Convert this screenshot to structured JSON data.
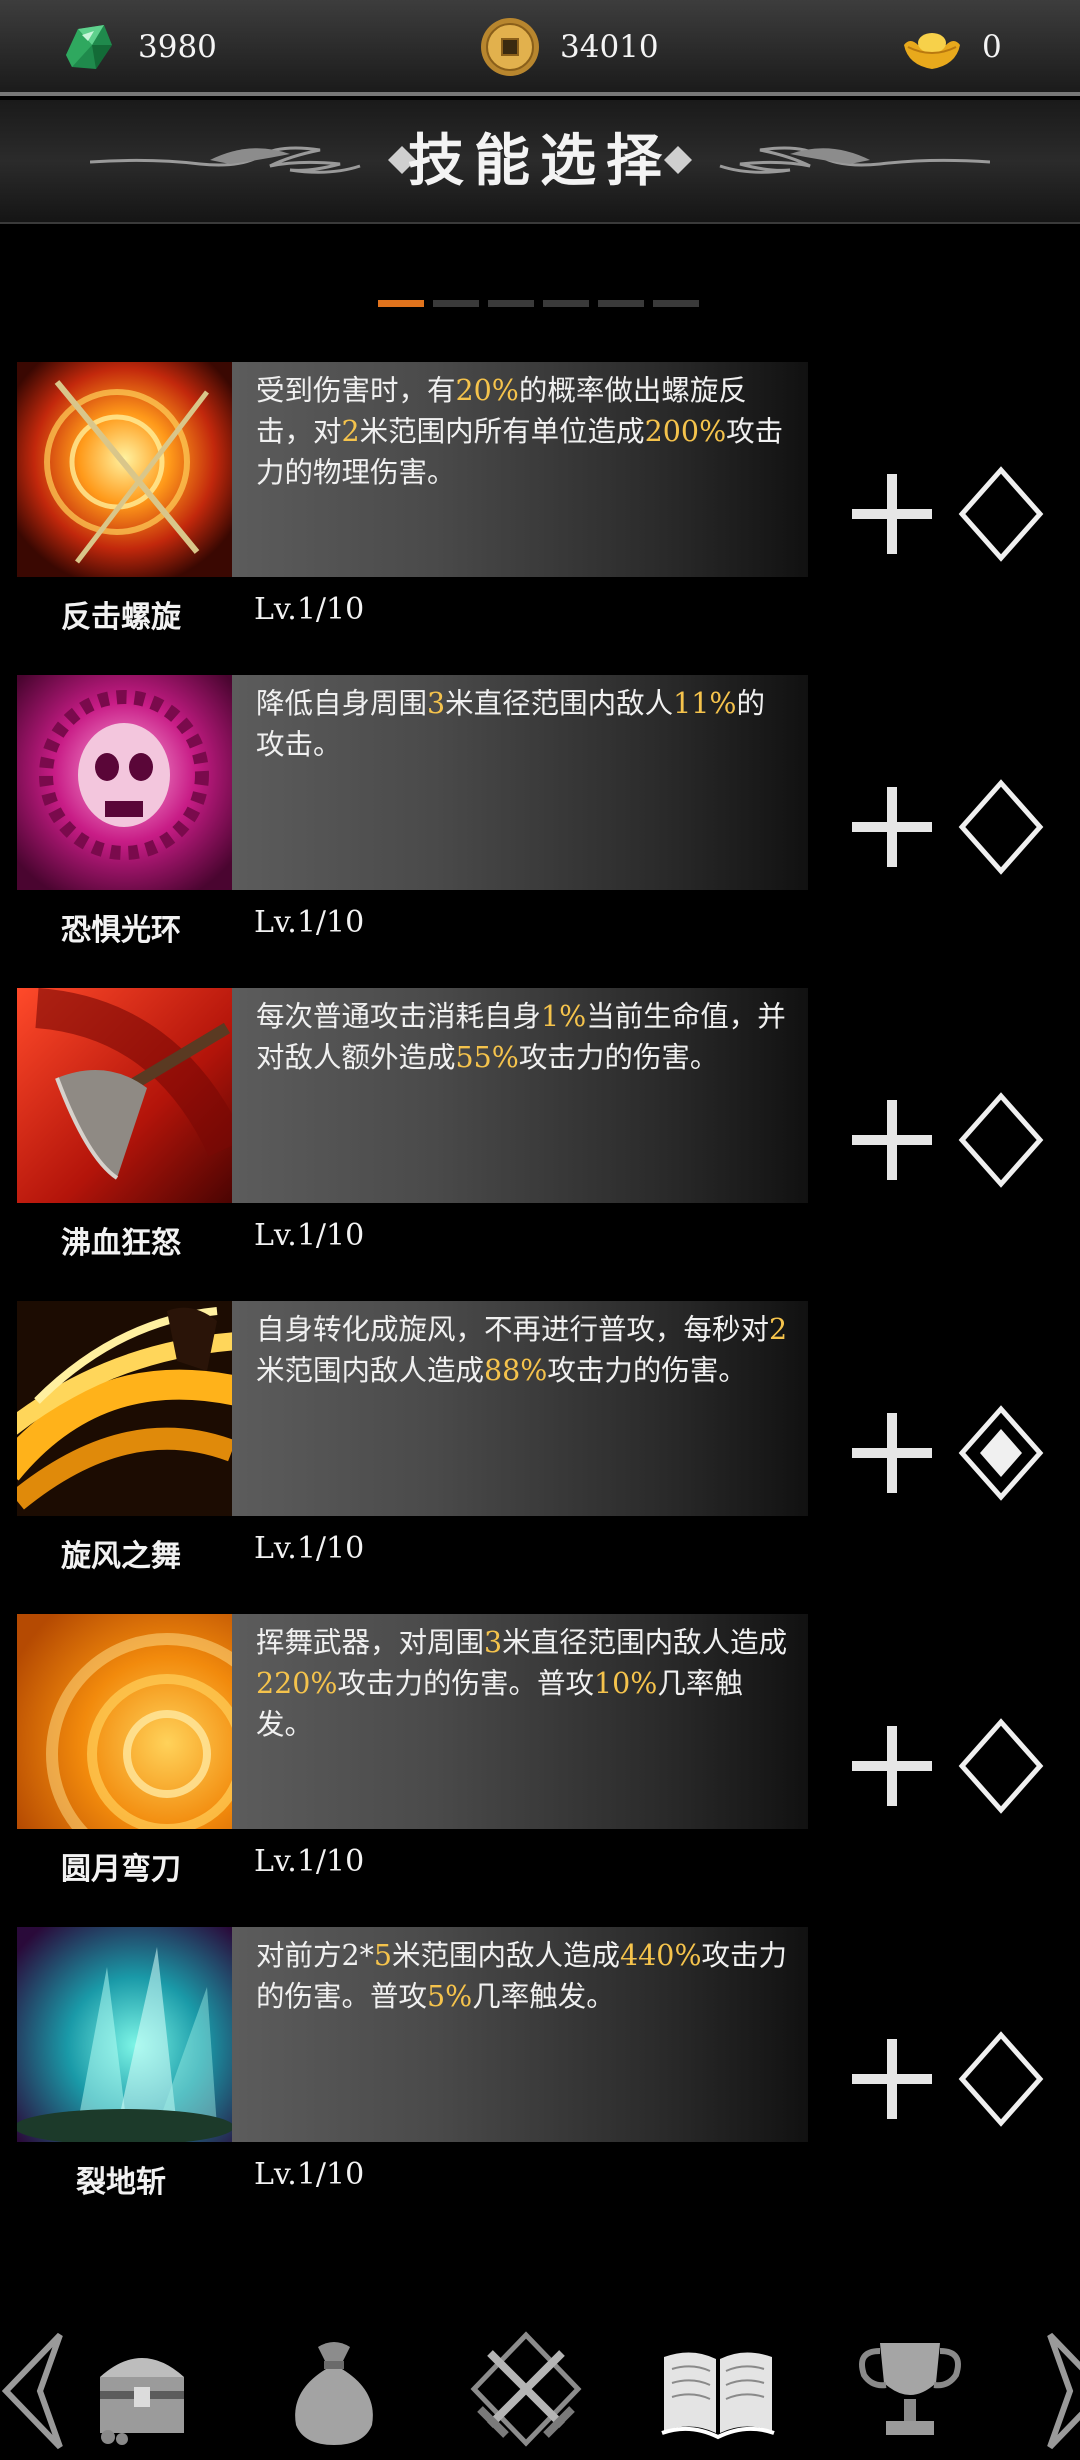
{
  "currency": {
    "gems": {
      "value": "3980",
      "icon": "green-gem-icon"
    },
    "coins": {
      "value": "34010",
      "icon": "copper-coin-icon"
    },
    "gold": {
      "value": "0",
      "icon": "gold-ingot-icon"
    }
  },
  "header": {
    "title": "技能选择"
  },
  "pager": {
    "pages": 6,
    "active": 0
  },
  "skills": [
    {
      "name": "反击螺旋",
      "level": "Lv.1/10",
      "icon": "counter-spiral-icon",
      "equipped": false,
      "desc": [
        {
          "t": "受到伤害时，有"
        },
        {
          "t": "20%",
          "hl": true
        },
        {
          "t": "的概率做出螺旋反击，对"
        },
        {
          "t": "2",
          "hl": true
        },
        {
          "t": "米范围内所有单位造成"
        },
        {
          "t": "200%",
          "hl": true
        },
        {
          "t": "攻击力的物理伤害。"
        }
      ]
    },
    {
      "name": "恐惧光环",
      "level": "Lv.1/10",
      "icon": "fear-aura-skull-icon",
      "equipped": false,
      "desc": [
        {
          "t": "降低自身周围"
        },
        {
          "t": "3",
          "hl": true
        },
        {
          "t": "米直径范围内敌人"
        },
        {
          "t": "11%",
          "hl": true
        },
        {
          "t": "的攻击。"
        }
      ]
    },
    {
      "name": "沸血狂怒",
      "level": "Lv.1/10",
      "icon": "blood-rage-axe-icon",
      "equipped": false,
      "desc": [
        {
          "t": "每次普通攻击消耗自身"
        },
        {
          "t": "1%",
          "hl": true
        },
        {
          "t": "当前生命值，并对敌人额外造成"
        },
        {
          "t": "55%",
          "hl": true
        },
        {
          "t": "攻击力的伤害。"
        }
      ]
    },
    {
      "name": "旋风之舞",
      "level": "Lv.1/10",
      "icon": "whirlwind-dance-icon",
      "equipped": true,
      "desc": [
        {
          "t": "自身转化成旋风，不再进行普攻，每秒对"
        },
        {
          "t": "2",
          "hl": true
        },
        {
          "t": "米范围内敌人造成"
        },
        {
          "t": "88%",
          "hl": true
        },
        {
          "t": "攻击力的伤害。"
        }
      ]
    },
    {
      "name": "圆月弯刀",
      "level": "Lv.1/10",
      "icon": "crescent-blade-icon",
      "equipped": false,
      "desc": [
        {
          "t": "挥舞武器，对周围"
        },
        {
          "t": "3",
          "hl": true
        },
        {
          "t": "米直径范围内敌人造成"
        },
        {
          "t": "220%",
          "hl": true
        },
        {
          "t": "攻击力的伤害。普攻"
        },
        {
          "t": "10%",
          "hl": true
        },
        {
          "t": "几率触发。"
        }
      ]
    },
    {
      "name": "裂地斩",
      "level": "Lv.1/10",
      "icon": "earth-split-slash-icon",
      "equipped": false,
      "desc": [
        {
          "t": "对前方2*"
        },
        {
          "t": "5",
          "hl": true
        },
        {
          "t": "米范围内敌人造成"
        },
        {
          "t": "440%",
          "hl": true
        },
        {
          "t": "攻击力的伤害。普攻"
        },
        {
          "t": "5%",
          "hl": true
        },
        {
          "t": "几率触发。"
        }
      ]
    }
  ],
  "bottom_nav": [
    {
      "icon": "treasure-chest-icon"
    },
    {
      "icon": "money-bag-icon"
    },
    {
      "icon": "crossed-swords-icon"
    },
    {
      "icon": "open-book-icon",
      "active": true
    },
    {
      "icon": "trophy-icon"
    }
  ],
  "colors": {
    "highlight": "#f5c34c",
    "pager_active": "#e0731d",
    "background": "#000000"
  }
}
